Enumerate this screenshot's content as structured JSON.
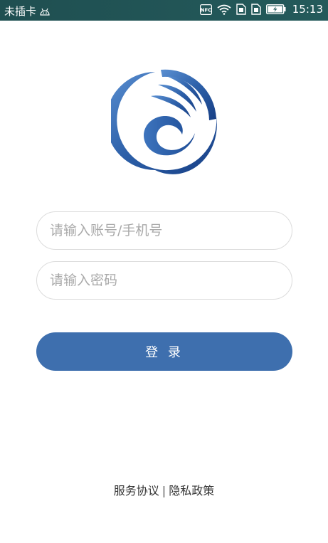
{
  "status_bar": {
    "carrier": "未插卡",
    "nfc_label": "NFC",
    "time": "15:13",
    "icons": [
      "android-debug-icon",
      "nfc-icon",
      "wifi-icon",
      "sim1-icon",
      "sim2-icon",
      "battery-charging-icon"
    ]
  },
  "login": {
    "logo_icon": "brand-logo-icon",
    "account_placeholder": "请输入账号/手机号",
    "account_value": "",
    "password_placeholder": "请输入密码",
    "password_value": "",
    "login_button_label": "登 录"
  },
  "footer": {
    "service_agreement": "服务协议",
    "separator": "|",
    "privacy_policy": "隐私政策"
  },
  "colors": {
    "status_bar": "#245a5b",
    "primary": "#3e6fae",
    "border": "#dcdcdc"
  }
}
